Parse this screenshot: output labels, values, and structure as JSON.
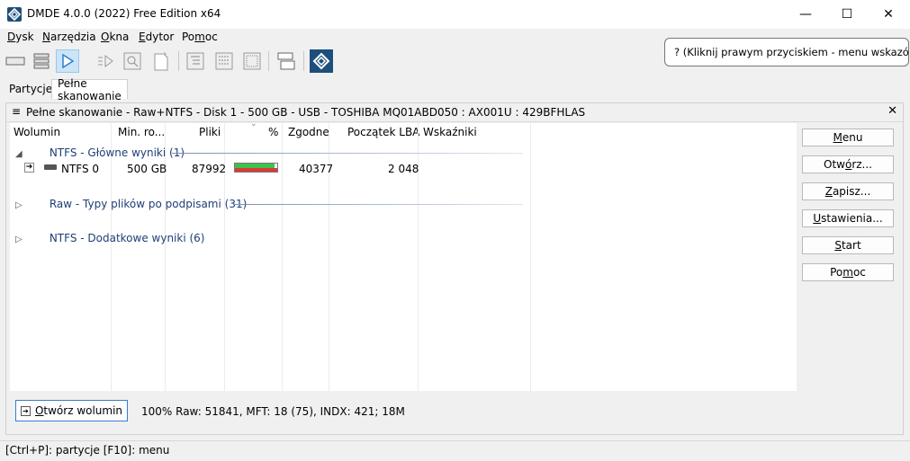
{
  "window": {
    "title": "DMDE 4.0.0 (2022) Free Edition x64",
    "minimize_glyph": "—",
    "maximize_glyph": "☐",
    "close_glyph": "✕"
  },
  "menu": {
    "items": [
      {
        "pre": "",
        "u": "D",
        "post": "ysk"
      },
      {
        "pre": "",
        "u": "N",
        "post": "arzędzia"
      },
      {
        "pre": "",
        "u": "O",
        "post": "kna"
      },
      {
        "pre": "",
        "u": "E",
        "post": "dytor"
      },
      {
        "pre": "Po",
        "u": "m",
        "post": "oc"
      }
    ]
  },
  "tooltip": {
    "text": "? (Kliknij prawym przyciskiem - menu wskazówek)"
  },
  "tabs": [
    {
      "label": "Partycje"
    },
    {
      "label": "Pełne skanowanie"
    }
  ],
  "panel": {
    "title": "Pełne skanowanie - Raw+NTFS - Disk 1 - 500 GB - USB - TOSHIBA MQ01ABD050 : AX001U : 429BFHLAS",
    "close_glyph": "✕"
  },
  "columns": [
    "Wolumin",
    "Min. ro...",
    "Pliki",
    "%",
    "Zgodne",
    "Początek LBA",
    "Wskaźniki"
  ],
  "groups": [
    {
      "label": "NTFS - Główne wyniki (1)",
      "expanded": true
    },
    {
      "label": "Raw - Typy plików po podpisami (31)",
      "expanded": false
    },
    {
      "label": "NTFS - Dodatkowe wyniki (6)",
      "expanded": false
    }
  ],
  "row": {
    "name": "NTFS 0",
    "size": "500 GB",
    "files": "87992",
    "green_fraction": 0.93,
    "red_fraction": 1.0,
    "matched": "40377",
    "start_lba": "2 048"
  },
  "side_buttons": [
    {
      "pre": "",
      "u": "M",
      "post": "enu"
    },
    {
      "pre": "Otw",
      "u": "ó",
      "post": "rz..."
    },
    {
      "pre": "",
      "u": "Z",
      "post": "apisz..."
    },
    {
      "pre": "",
      "u": "U",
      "post": "stawienia..."
    },
    {
      "pre": "",
      "u": "S",
      "post": "tart"
    },
    {
      "pre": "Po",
      "u": "m",
      "post": "oc"
    }
  ],
  "open_volume": {
    "pre": "",
    "u": "O",
    "post": "twórz wolumin"
  },
  "scan_status": "100% Raw: 51841, MFT: 18 (75), INDX: 421; 18M",
  "statusbar": "[Ctrl+P]: partycje  [F10]: menu"
}
